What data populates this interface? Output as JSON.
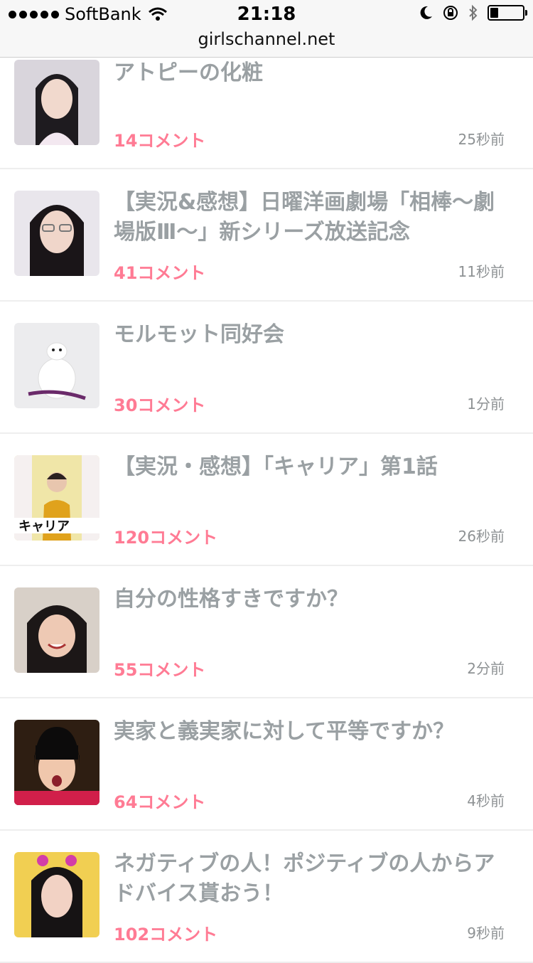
{
  "status": {
    "carrier": "SoftBank",
    "time": "21:18",
    "icons": [
      "wifi-icon",
      "moon-icon",
      "rotation-lock-icon",
      "bluetooth-icon",
      "battery-icon"
    ],
    "battery_level": 0.25
  },
  "url": "girlschannel.net",
  "colors": {
    "title": "#9aa0a3",
    "comments": "#ff7b94",
    "time": "#8e9294",
    "divider": "#eeeeee"
  },
  "items": [
    {
      "title": "アトピーの化粧",
      "comments": "14コメント",
      "time": "25秒前"
    },
    {
      "title": "【実況&感想】日曜洋画劇場「相棒〜劇場版Ⅲ〜」新シリーズ放送記念",
      "comments": "41コメント",
      "time": "11秒前"
    },
    {
      "title": "モルモット同好会",
      "comments": "30コメント",
      "time": "1分前"
    },
    {
      "title": "【実況・感想】「キャリア」第1話",
      "comments": "120コメント",
      "time": "26秒前"
    },
    {
      "title": "自分の性格すきですか？",
      "comments": "55コメント",
      "time": "2分前"
    },
    {
      "title": "実家と義実家に対して平等ですか？",
      "comments": "64コメント",
      "time": "4秒前"
    },
    {
      "title": "ネガティブの人！ポジティブの人からアドバイス貰おう！",
      "comments": "102コメント",
      "time": "9秒前"
    }
  ]
}
